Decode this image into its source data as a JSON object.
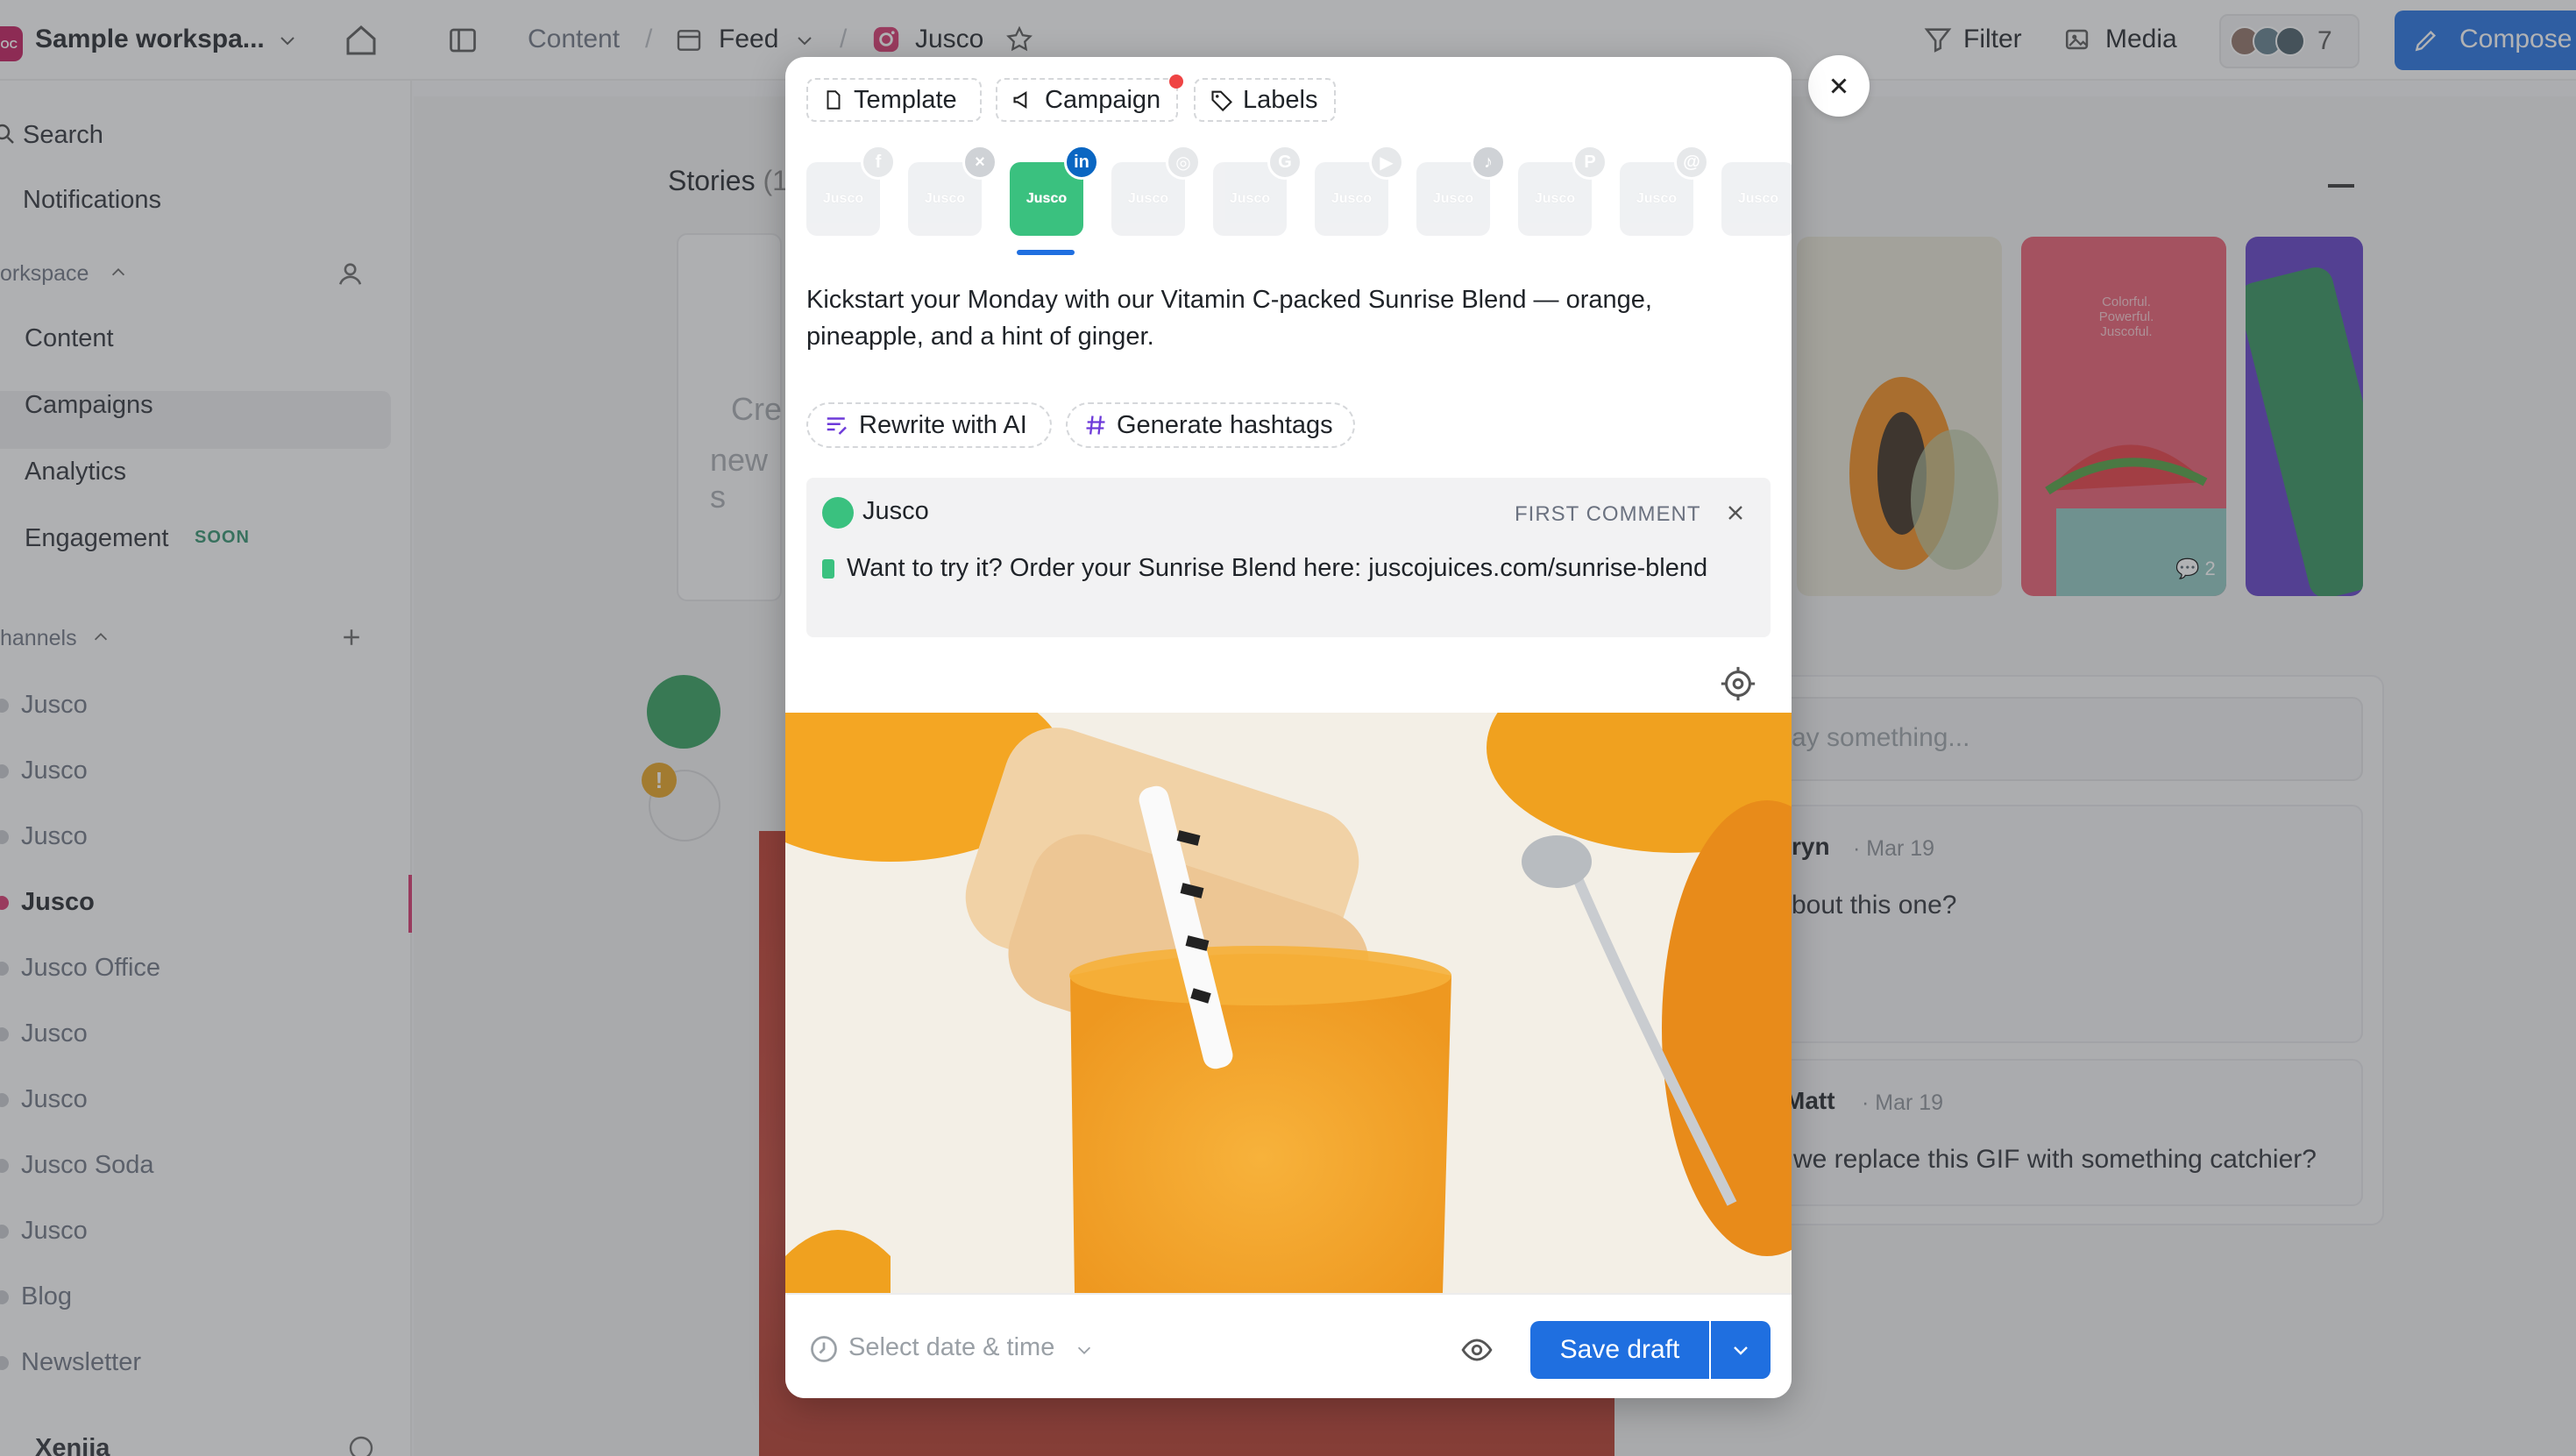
{
  "topbar": {
    "workspace_logo": "OC",
    "workspace_name": "Sample workspa...",
    "breadcrumb_content": "Content",
    "breadcrumb_sep": "/",
    "breadcrumb_feed": "Feed",
    "breadcrumb_channel": "Jusco",
    "filter_label": "Filter",
    "media_label": "Media",
    "member_count": "7",
    "compose_label": "Compose"
  },
  "sidebar": {
    "search": "Search",
    "notifications": "Notifications",
    "workspace_section": "orkspace",
    "nav": [
      "Content",
      "Campaigns",
      "Analytics",
      "Engagement"
    ],
    "soon_badge": "SOON",
    "channels_section": "hannels",
    "channels": [
      "Jusco",
      "Jusco",
      "Jusco",
      "Jusco",
      "Jusco Office",
      "Jusco",
      "Jusco",
      "Jusco Soda",
      "Jusco",
      "Blog",
      "Newsletter"
    ],
    "user_name": "Xenija"
  },
  "main": {
    "stories_label": "Stories",
    "stories_count": "(1",
    "create_text_1": "Cre",
    "create_text_2": "new s",
    "story_overlay_text": "Colorful. Powerful. Juscoful.",
    "story_comment_count": "2",
    "comment_placeholder": "ay something...",
    "comments": [
      {
        "author": "ryn",
        "date": "· Mar 19",
        "text": "bout this one?"
      },
      {
        "author": "Matt",
        "date": "· Mar 19",
        "text": "we replace this GIF with something catchier?"
      }
    ]
  },
  "modal": {
    "chips": {
      "template": "Template",
      "campaign": "Campaign",
      "labels": "Labels"
    },
    "channel_tile_label": "Jusco",
    "channels": [
      {
        "network": "facebook",
        "icon": "facebook-icon",
        "active": false
      },
      {
        "network": "x",
        "icon": "x-icon",
        "active": false
      },
      {
        "network": "linkedin",
        "icon": "linkedin-icon",
        "active": true
      },
      {
        "network": "instagram",
        "icon": "instagram-icon",
        "active": false
      },
      {
        "network": "google",
        "icon": "google-icon",
        "active": false
      },
      {
        "network": "youtube",
        "icon": "youtube-icon",
        "active": false
      },
      {
        "network": "tiktok",
        "icon": "tiktok-icon",
        "active": false
      },
      {
        "network": "pinterest",
        "icon": "pinterest-icon",
        "active": false
      },
      {
        "network": "threads",
        "icon": "threads-icon",
        "active": false
      },
      {
        "network": "other",
        "icon": "jusco-icon",
        "active": false
      }
    ],
    "post_text": "Kickstart your Monday with our Vitamin C-packed Sunrise Blend — orange, pineapple, and a hint of ginger.",
    "ai_actions": {
      "rewrite": "Rewrite with AI",
      "hashtags": "Generate hashtags"
    },
    "first_comment": {
      "author": "Jusco",
      "label": "FIRST COMMENT",
      "text": "Want to try it? Order your Sunrise Blend here: juscojuices.com/sunrise-blend"
    },
    "footer": {
      "date_placeholder": "Select date & time",
      "save_label": "Save draft"
    }
  },
  "colors": {
    "accent": "#1f6fe0",
    "linkedin": "#0a66c2",
    "jusco_green": "#3ac17f",
    "campaign_dot": "#ef4444"
  }
}
